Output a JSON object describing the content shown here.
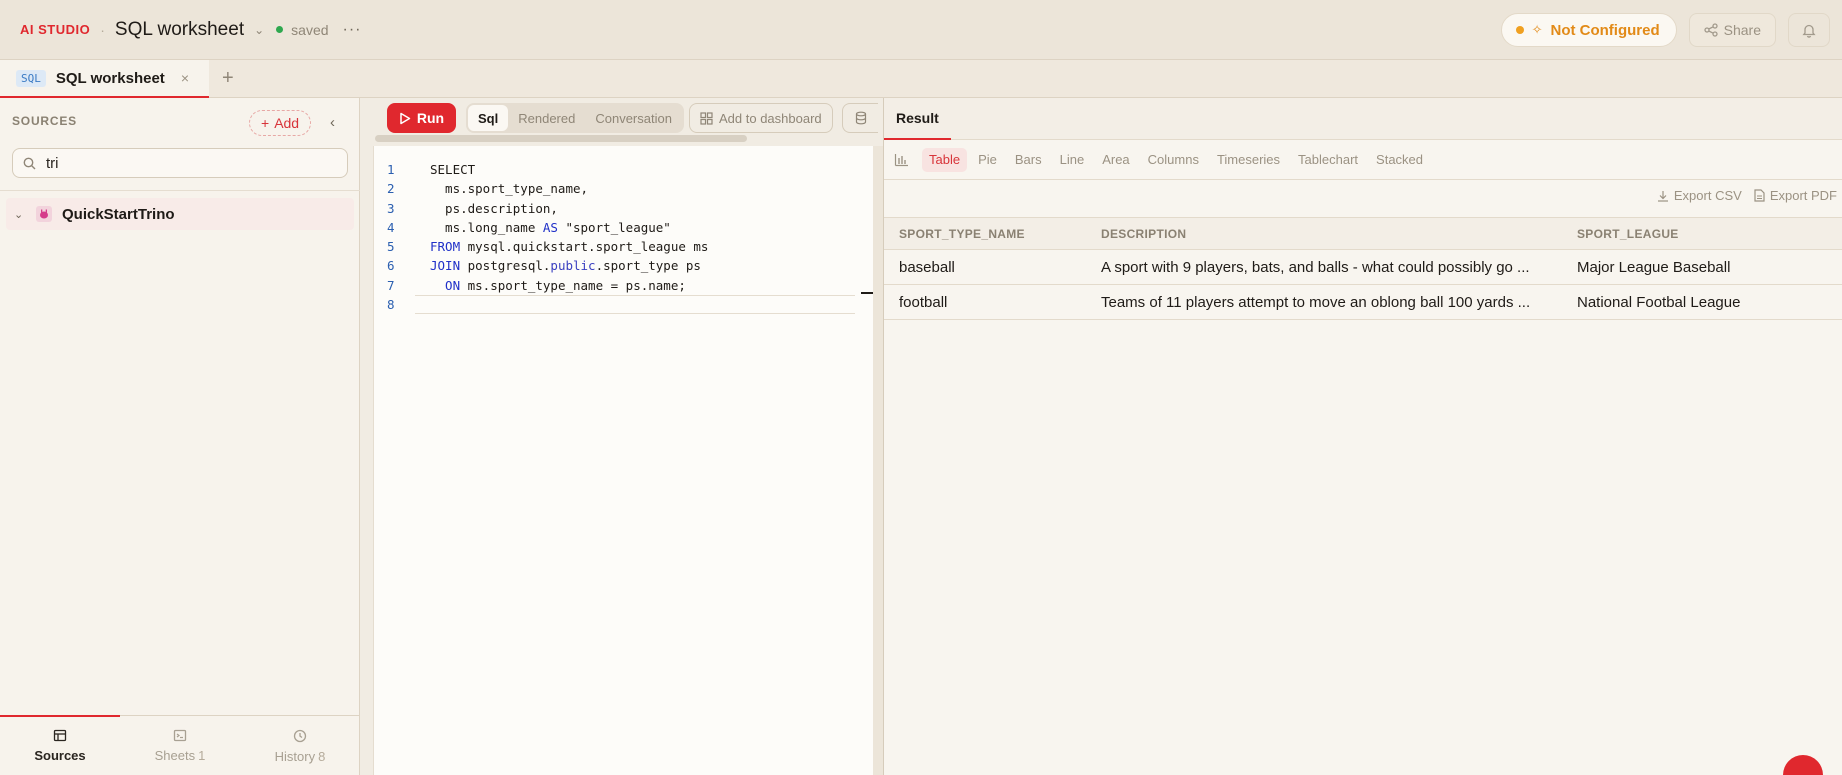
{
  "header": {
    "brand": "AI STUDIO",
    "separator": "·",
    "worksheet_title": "SQL worksheet",
    "status": "saved",
    "more": "···",
    "not_configured": "Not Configured",
    "share": "Share"
  },
  "tabs": {
    "active_badge": "SQL",
    "active_label": "SQL worksheet",
    "close": "×",
    "add": "+"
  },
  "sidebar": {
    "title": "SOURCES",
    "add_label": "Add",
    "search_value": "tri",
    "tree": [
      {
        "name": "QuickStartTrino"
      }
    ],
    "bottom_tabs": [
      {
        "label": "Sources",
        "count": ""
      },
      {
        "label": "Sheets",
        "count": "1"
      },
      {
        "label": "History",
        "count": "8"
      }
    ]
  },
  "editor": {
    "run_label": "Run",
    "modes": [
      "Sql",
      "Rendered",
      "Conversation"
    ],
    "active_mode": "Sql",
    "add_dashboard": "Add to dashboard",
    "lines": [
      {
        "no": "1"
      },
      {
        "no": "2"
      },
      {
        "no": "3"
      },
      {
        "no": "4"
      },
      {
        "no": "5"
      },
      {
        "no": "6"
      },
      {
        "no": "7"
      },
      {
        "no": "8"
      }
    ],
    "code": {
      "l1": "SELECT",
      "l2": "  ms.sport_type_name,",
      "l3": "  ps.description,",
      "l4a": "  ms.long_name ",
      "l4kw": "AS",
      "l4b": " \"sport_league\"",
      "l5kw": "FROM",
      "l5": " mysql.quickstart.sport_league ms",
      "l6kw": "JOIN",
      "l6a": " postgresql.",
      "l6kw2": "public",
      "l6b": ".sport_type ps",
      "l7kw": "  ON",
      "l7": " ms.sport_type_name = ps.name;",
      "l8": ""
    }
  },
  "result": {
    "tab": "Result",
    "viz_types": [
      "Table",
      "Pie",
      "Bars",
      "Line",
      "Area",
      "Columns",
      "Timeseries",
      "Tablechart",
      "Stacked"
    ],
    "active_viz": "Table",
    "export_csv": "Export CSV",
    "export_pdf": "Export PDF",
    "columns": [
      "SPORT_TYPE_NAME",
      "DESCRIPTION",
      "SPORT_LEAGUE"
    ],
    "rows": [
      [
        "baseball",
        "A sport with 9 players, bats, and balls - what could possibly go ...",
        "Major League Baseball"
      ],
      [
        "football",
        "Teams of 11 players attempt to move an oblong ball 100 yards ...",
        "National Footbal League"
      ]
    ]
  },
  "colors": {
    "accent": "#e0282e",
    "warning": "#e28a17",
    "saved": "#2fa84f",
    "keyword": "#2030c8"
  }
}
